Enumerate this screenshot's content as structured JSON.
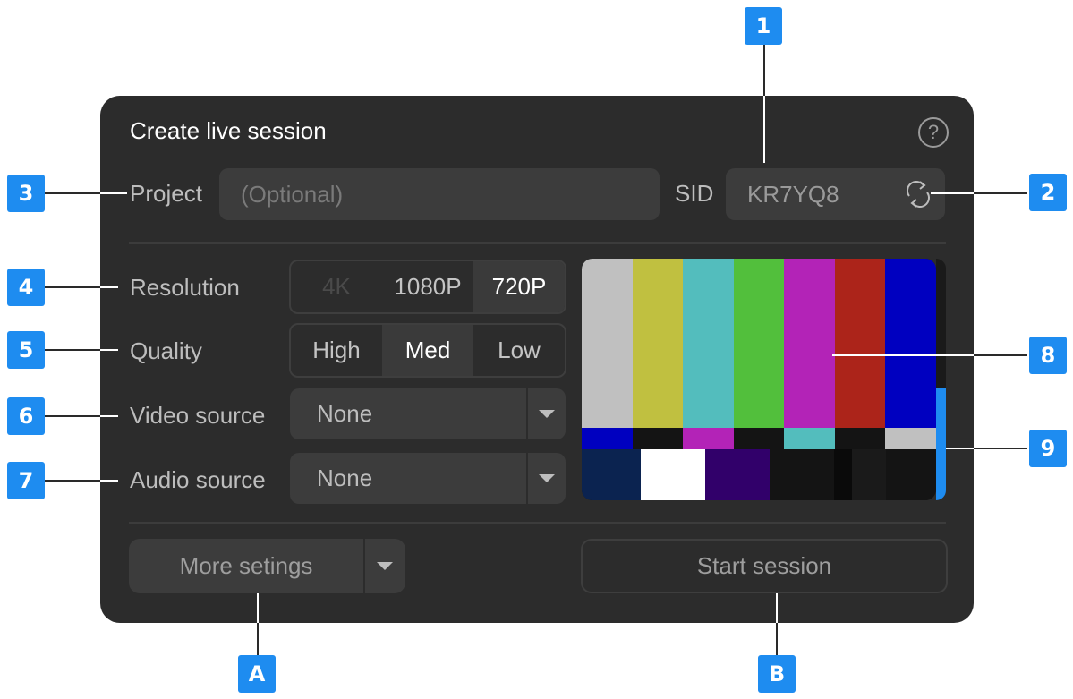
{
  "title": "Create live session",
  "help_icon": "?",
  "project": {
    "label": "Project",
    "placeholder": "(Optional)"
  },
  "sid": {
    "label": "SID",
    "value": "KR7YQ8"
  },
  "resolution": {
    "label": "Resolution",
    "options": [
      "4K",
      "1080P",
      "720P"
    ],
    "selected": "720P",
    "disabled": "4K"
  },
  "quality": {
    "label": "Quality",
    "options": [
      "High",
      "Med",
      "Low"
    ],
    "selected": "Med"
  },
  "video_source": {
    "label": "Video source",
    "value": "None"
  },
  "audio_source": {
    "label": "Audio source",
    "value": "None"
  },
  "more_settings": "More setings",
  "start_session": "Start session",
  "annotations": [
    "1",
    "2",
    "3",
    "4",
    "5",
    "6",
    "7",
    "8",
    "9",
    "A",
    "B"
  ],
  "preview": {
    "top_bars": [
      "#c0c0c0",
      "#c0c040",
      "#53bdbd",
      "#52bf3c",
      "#b323b7",
      "#ac241a",
      "#0000c0"
    ],
    "strip": [
      "#0000c0",
      "#141414",
      "#b323b7",
      "#141414",
      "#53bdbd",
      "#141414",
      "#c0c0c0"
    ],
    "bottom": [
      "#0b2350",
      "#ffffff",
      "#31006a",
      "#141414",
      "#0a0a0a",
      "#1a1a1a",
      "#141414"
    ]
  },
  "colors": {
    "accent": "#1e8cf0",
    "panel": "#2c2c2c",
    "field": "#3c3c3c"
  }
}
